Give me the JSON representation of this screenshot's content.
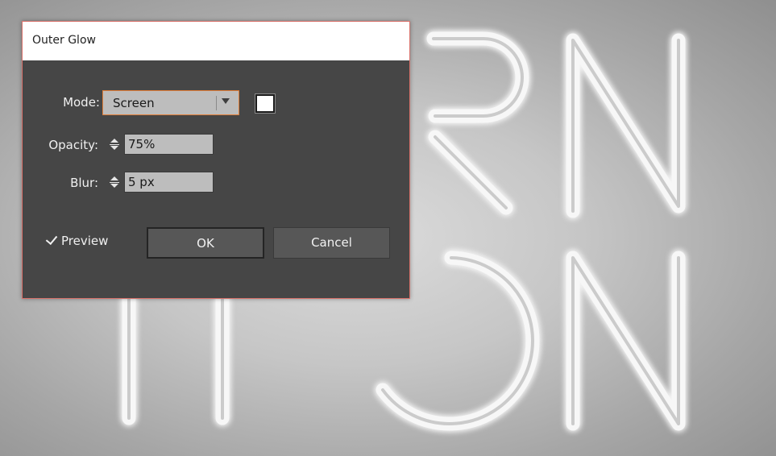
{
  "dialog": {
    "title": "Outer Glow",
    "mode": {
      "label": "Mode:",
      "value": "Screen"
    },
    "glow_color": "#ffffff",
    "opacity": {
      "label": "Opacity:",
      "value": "75%"
    },
    "blur": {
      "label": "Blur:",
      "value": "5 px"
    },
    "preview": {
      "label": "Preview",
      "checked": true
    },
    "ok_label": "OK",
    "cancel_label": "Cancel"
  },
  "artwork": {
    "description_letters": [
      "R",
      "N",
      "T",
      "T",
      "O",
      "N"
    ],
    "background_color": "#c8c8c8",
    "neon_color": "#f4f4f4"
  }
}
